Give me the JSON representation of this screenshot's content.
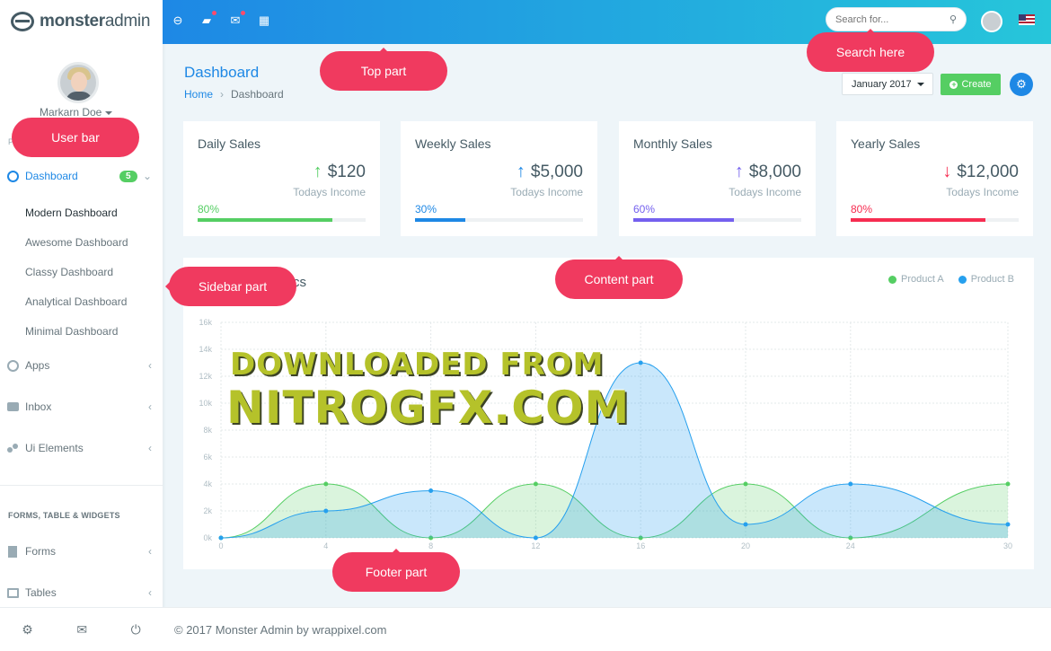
{
  "brand": {
    "name_bold": "monster",
    "name_light": "admin"
  },
  "user": {
    "name": "Markarn Doe"
  },
  "sidebar": {
    "section_small": "P",
    "dashboard": {
      "label": "Dashboard",
      "badge": "5"
    },
    "sub_items": [
      "Modern Dashboard",
      "Awesome Dashboard",
      "Classy Dashboard",
      "Analytical Dashboard",
      "Minimal Dashboard"
    ],
    "items": [
      {
        "label": "Apps",
        "icon": "apps-icon"
      },
      {
        "label": "Inbox",
        "icon": "inbox-icon"
      },
      {
        "label": "Ui Elements",
        "icon": "ui-elements-icon"
      }
    ],
    "section_label": "FORMS, TABLE & WIDGETS",
    "items2": [
      {
        "label": "Forms",
        "icon": "forms-icon"
      },
      {
        "label": "Tables",
        "icon": "tables-icon"
      }
    ],
    "bottom_icons": [
      "settings-icon",
      "mail-icon",
      "power-icon"
    ]
  },
  "topbar": {
    "search_placeholder": "Search for..."
  },
  "page": {
    "title": "Dashboard",
    "breadcrumb": {
      "home": "Home",
      "current": "Dashboard"
    },
    "month": "January 2017",
    "create_label": "Create"
  },
  "cards": [
    {
      "title": "Daily Sales",
      "amount": "$120",
      "sub": "Todays Income",
      "pct": "80%",
      "color": "#55ce63",
      "arrow": "↑"
    },
    {
      "title": "Weekly Sales",
      "amount": "$5,000",
      "sub": "Todays Income",
      "pct": "30%",
      "color": "#1e88e5",
      "arrow": "↑"
    },
    {
      "title": "Monthly Sales",
      "amount": "$8,000",
      "sub": "Todays Income",
      "pct": "60%",
      "color": "#7460ee",
      "arrow": "↑"
    },
    {
      "title": "Yearly Sales",
      "amount": "$12,000",
      "sub": "Todays Income",
      "pct": "80%",
      "color": "#f62d51",
      "arrow": "↓"
    }
  ],
  "chart": {
    "title_visible": "stics",
    "legend": [
      "Product A",
      "Product B"
    ]
  },
  "chart_data": {
    "type": "area",
    "x": [
      0,
      4,
      8,
      12,
      16,
      20,
      24,
      30
    ],
    "ylim": [
      0,
      16000
    ],
    "yticks": [
      "0k",
      "2k",
      "4k",
      "6k",
      "8k",
      "10k",
      "12k",
      "14k",
      "16k"
    ],
    "xticks": [
      "0",
      "4",
      "8",
      "12",
      "16",
      "20",
      "24",
      "30"
    ],
    "series": [
      {
        "name": "Product A",
        "color": "#55ce63",
        "values": [
          0,
          4000,
          0,
          4000,
          0,
          4000,
          0,
          4000
        ]
      },
      {
        "name": "Product B",
        "color": "#26a0ee",
        "values": [
          0,
          2000,
          3500,
          0,
          13000,
          1000,
          4000,
          1000
        ]
      }
    ]
  },
  "footer": {
    "text": "© 2017 Monster Admin by wrappixel.com"
  },
  "callouts": {
    "top": "Top part",
    "search": "Search here",
    "user": "User bar",
    "sidebar": "Sidebar part",
    "content": "Content part",
    "footer": "Footer part"
  },
  "watermark": {
    "line1": "DOWNLOADED FROM",
    "line2": "NITROGFX.COM"
  }
}
